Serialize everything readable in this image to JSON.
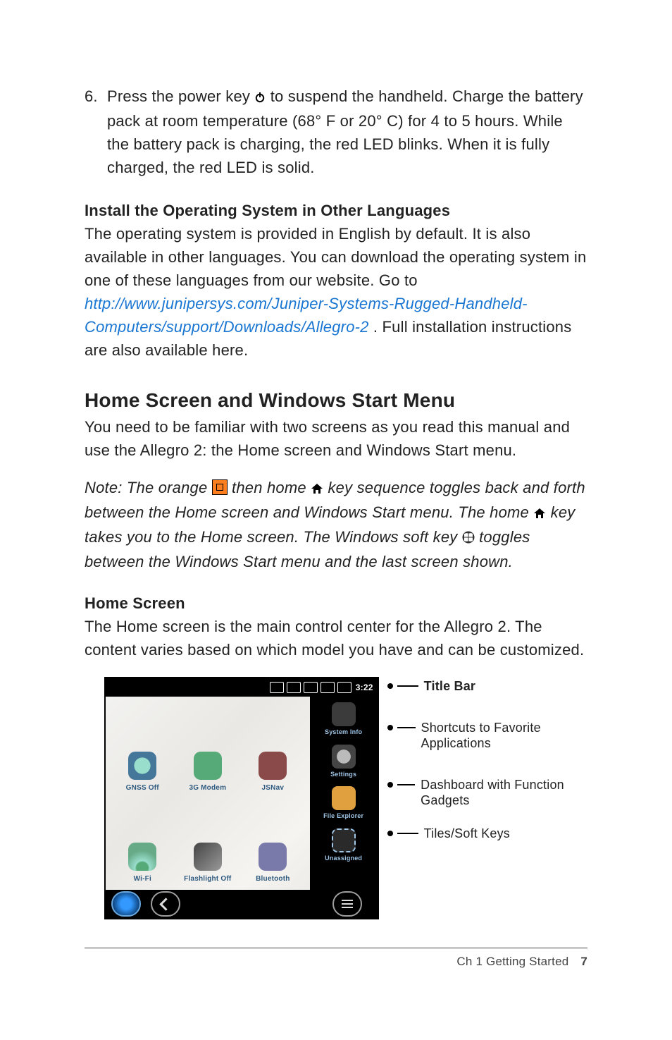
{
  "step6": {
    "num": "6.",
    "text_pre": "Press the power key ",
    "text_post": " to suspend the handheld. Charge the battery pack at room temperature (68° F or 20° C) for 4 to 5 hours. While the battery pack is charging, the red LED blinks. When it is fully charged, the red LED is solid."
  },
  "install": {
    "heading": "Install the Operating System in Other Languages",
    "p_pre": "The operating system is provided in English by default. It is also available in other languages. You can download the operating system in one of these languages from our website. Go to ",
    "link": "http://www.junipersys.com/Juniper-Systems-Rugged-Handheld-Computers/support/Downloads/Allegro-2",
    "p_post": ". Full installation instructions are also available here."
  },
  "home_menu": {
    "heading": "Home Screen and Windows Start Menu",
    "p": "You need to be familiar with two screens as you read this manual and use the Allegro 2: the Home screen and Windows Start menu."
  },
  "note": {
    "t1": "Note: The orange ",
    "t2": " then home ",
    "t3": " key sequence toggles back and forth between the Home screen and Windows Start menu. The home ",
    "t4": " key takes you to the Home screen. The Windows soft key ",
    "t5": " toggles between the Windows Start menu and the last screen shown."
  },
  "home_screen": {
    "heading": "Home Screen",
    "p": "The Home screen is the main control center for the Allegro 2. The content varies based on which model you have and can be customized."
  },
  "figure": {
    "clock": "3:22",
    "gadgets": [
      "GNSS Off",
      "3G Modem",
      "JSNav",
      "Wi-Fi",
      "Flashlight Off",
      "Bluetooth"
    ],
    "shortcuts": [
      "System Info",
      "Settings",
      "File Explorer",
      "Unassigned"
    ],
    "labels": {
      "titlebar": "Title Bar",
      "shortcuts": "Shortcuts to Favorite Applications",
      "dashboard": "Dashboard with Function Gadgets",
      "tiles": "Tiles/Soft Keys"
    }
  },
  "footer": {
    "chapter": "Ch 1   Getting Started",
    "page": "7"
  }
}
